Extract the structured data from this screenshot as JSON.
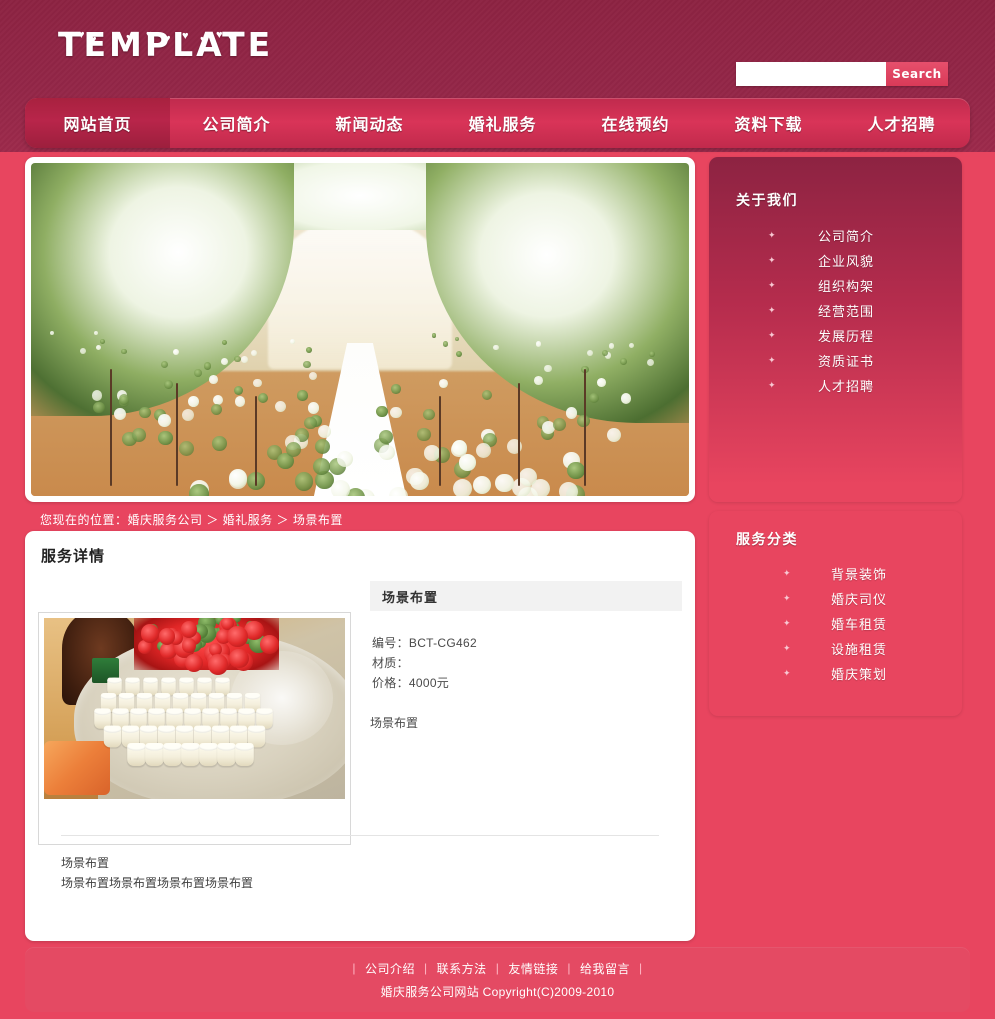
{
  "header": {
    "logo_text": "TEMPLATE",
    "search": {
      "value": "",
      "placeholder": "",
      "button_label": "Search",
      "icon": "search-icon"
    }
  },
  "nav": {
    "items": [
      {
        "label": "网站首页",
        "active": true
      },
      {
        "label": "公司简介",
        "active": false
      },
      {
        "label": "新闻动态",
        "active": false
      },
      {
        "label": "婚礼服务",
        "active": false
      },
      {
        "label": "在线预约",
        "active": false
      },
      {
        "label": "资料下载",
        "active": false
      },
      {
        "label": "人才招聘",
        "active": false
      }
    ]
  },
  "banner": {
    "alt": "婚礼现场鲜花拱门与白色地毯通道"
  },
  "breadcrumb": {
    "text": "您现在的位置：婚庆服务公司 ＞ 婚礼服务 ＞ 场景布置"
  },
  "content": {
    "title": "服务详情",
    "thumb_alt": "圆桌上的纸杯与红玫瑰花束",
    "product": {
      "name": "场景布置",
      "fields": [
        {
          "label": "编号：",
          "value": "BCT-CG462"
        },
        {
          "label": "材质：",
          "value": ""
        },
        {
          "label": "价格：",
          "value": "4000元"
        }
      ],
      "short_desc": "场景布置"
    },
    "description_lines": [
      "场景布置",
      "场景布置场景布置场景布置场景布置"
    ]
  },
  "sidebar": {
    "about": {
      "title": "关于我们",
      "items": [
        {
          "label": "公司简介"
        },
        {
          "label": "企业风貌"
        },
        {
          "label": "组织构架"
        },
        {
          "label": "经营范围"
        },
        {
          "label": "发展历程"
        },
        {
          "label": "资质证书"
        },
        {
          "label": "人才招聘"
        }
      ]
    },
    "service": {
      "title": "服务分类",
      "items": [
        {
          "label": "背景装饰"
        },
        {
          "label": "婚庆司仪"
        },
        {
          "label": "婚车租赁"
        },
        {
          "label": "设施租赁"
        },
        {
          "label": "婚庆策划"
        }
      ]
    }
  },
  "footer": {
    "links": [
      {
        "label": "公司介绍"
      },
      {
        "label": "联系方法"
      },
      {
        "label": "友情链接"
      },
      {
        "label": "给我留言"
      }
    ],
    "copyright": "婚庆服务公司网站 Copyright(C)2009-2010"
  },
  "colors": {
    "page_bg": "#e8455f",
    "header_dark": "#8d2342",
    "nav_gradient_top": "#bf2a4d",
    "nav_active": "#a8213f",
    "accent_button": "#d93a58",
    "panel_white": "#ffffff",
    "title_bar_gray": "#f2f2f2"
  }
}
